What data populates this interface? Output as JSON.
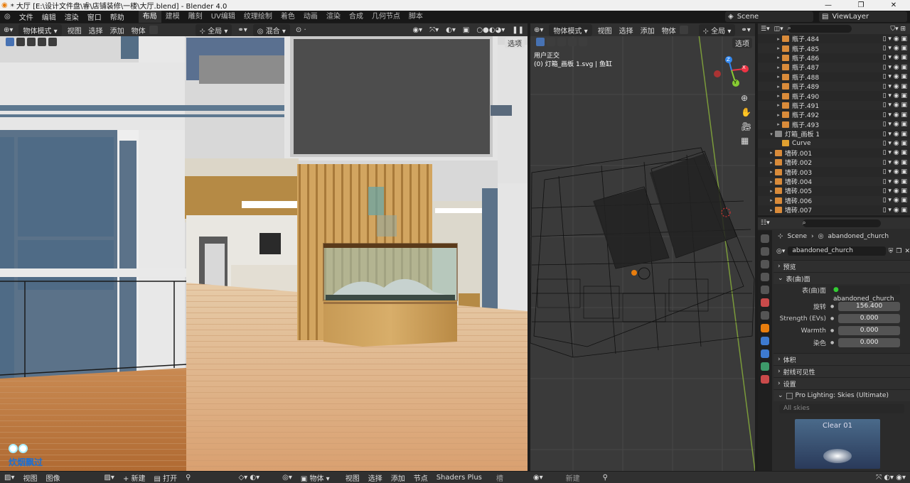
{
  "window": {
    "title": "* 大厅 [E:\\设计文件盘\\睿\\店铺装修\\一楼\\大厅.blend] - Blender 4.0",
    "buttons": [
      "—",
      "❐",
      "✕"
    ]
  },
  "menubar": {
    "menus": [
      "文件",
      "编辑",
      "渲染",
      "窗口",
      "帮助"
    ],
    "workspaces": [
      "布局",
      "建模",
      "雕刻",
      "UV编辑",
      "纹理绘制",
      "着色",
      "动画",
      "渲染",
      "合成",
      "几何节点",
      "脚本"
    ],
    "active_workspace": "布局",
    "scene": "Scene",
    "view_layer": "ViewLayer"
  },
  "left_viewport": {
    "mode": "物体模式",
    "menus": [
      "视图",
      "选择",
      "添加",
      "物体"
    ],
    "orientation": "全局",
    "snap_mode": "混合",
    "options": "选项"
  },
  "right_viewport": {
    "mode": "物体模式",
    "menus": [
      "视图",
      "选择",
      "添加",
      "物体"
    ],
    "orientation": "全局",
    "options": "选项",
    "view_name": "用户正交",
    "view_info": "(0) 灯箱_画板 1.svg | 鱼缸",
    "gizmo": {
      "x": "X",
      "y": "Y",
      "z": "Z"
    }
  },
  "watermark": "炊烟飘过",
  "outliner": {
    "search_placeholder": "",
    "items": [
      {
        "name": "瓶子.484",
        "type": "mesh",
        "indent": 2
      },
      {
        "name": "瓶子.485",
        "type": "mesh",
        "indent": 2
      },
      {
        "name": "瓶子.486",
        "type": "mesh",
        "indent": 2
      },
      {
        "name": "瓶子.487",
        "type": "mesh",
        "indent": 2
      },
      {
        "name": "瓶子.488",
        "type": "mesh",
        "indent": 2
      },
      {
        "name": "瓶子.489",
        "type": "mesh",
        "indent": 2
      },
      {
        "name": "瓶子.490",
        "type": "mesh",
        "indent": 2
      },
      {
        "name": "瓶子.491",
        "type": "mesh",
        "indent": 2
      },
      {
        "name": "瓶子.492",
        "type": "mesh",
        "indent": 2
      },
      {
        "name": "瓶子.493",
        "type": "mesh",
        "indent": 2
      },
      {
        "name": "灯箱_画板 1.svg",
        "type": "collection",
        "indent": 1
      },
      {
        "name": "Curve",
        "type": "curve",
        "indent": 2
      },
      {
        "name": "墙砖.001",
        "type": "mesh",
        "indent": 1
      },
      {
        "name": "墙砖.002",
        "type": "mesh",
        "indent": 1
      },
      {
        "name": "墙砖.003",
        "type": "mesh",
        "indent": 1
      },
      {
        "name": "墙砖.004",
        "type": "mesh",
        "indent": 1
      },
      {
        "name": "墙砖.005",
        "type": "mesh",
        "indent": 1
      },
      {
        "name": "墙砖.006",
        "type": "mesh",
        "indent": 1
      },
      {
        "name": "墙砖.007",
        "type": "mesh",
        "indent": 1
      },
      {
        "name": "墙砖.008",
        "type": "mesh",
        "indent": 1
      }
    ]
  },
  "properties": {
    "breadcrumb_scene": "Scene",
    "breadcrumb_world": "abandoned_church",
    "world_name": "abandoned_church",
    "panels": {
      "preview": "预览",
      "surface": "表(曲)面",
      "volume": "体积",
      "ray_visibility": "射线可见性",
      "settings": "设置",
      "addon": "Pro Lighting: Skies (Ultimate)"
    },
    "surface_label": "表(曲)面",
    "surface_value": "abandoned_church",
    "fields": [
      {
        "label": "旋转",
        "value": "156.400"
      },
      {
        "label": "Strength (EVs)",
        "value": "0.000"
      },
      {
        "label": "Warmth",
        "value": "0.000"
      },
      {
        "label": "染色",
        "value": "0.000"
      }
    ],
    "skies_dropdown": "All skies",
    "sky_thumb_label": "Clear 01"
  },
  "bottombar": {
    "left_menus": [
      "视图",
      "图像"
    ],
    "new_label": "新建",
    "open_label": "打开",
    "mode": "物体",
    "node_menus": [
      "视图",
      "选择",
      "添加",
      "节点"
    ],
    "shaders_plus": "Shaders Plus",
    "slot_label": "槽",
    "new_label2": "新建"
  }
}
